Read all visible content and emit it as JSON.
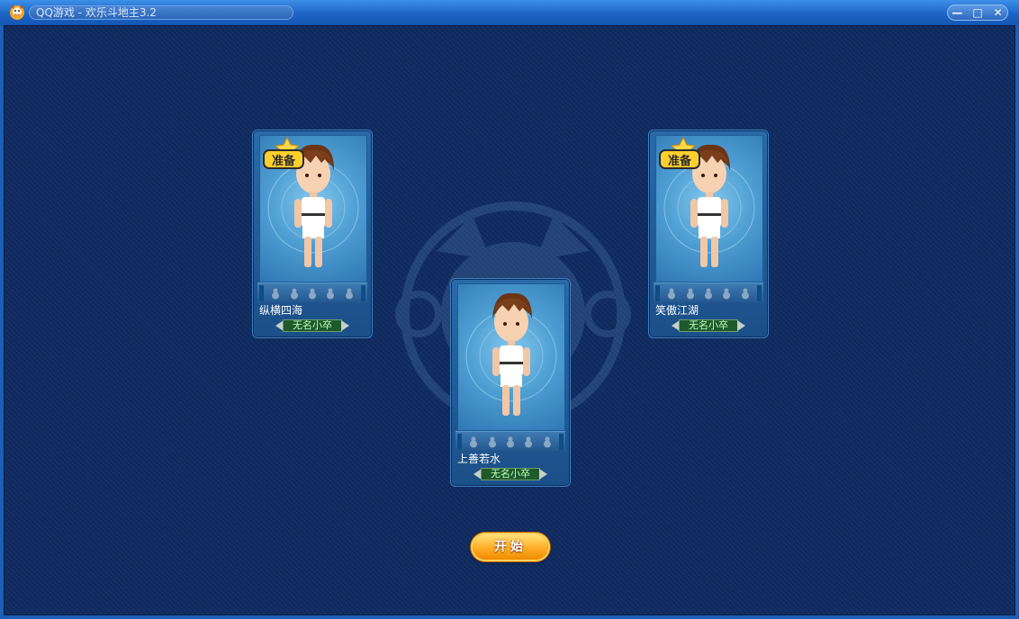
{
  "window": {
    "title": "QQ游戏 - 欢乐斗地主3.2",
    "controls": {
      "minimize": "—",
      "maximize": "□",
      "close": "✕"
    }
  },
  "players": [
    {
      "name": "纵横四海",
      "rank": "无名小卒",
      "status": "准备",
      "ready": true
    },
    {
      "name": "笑傲江湖",
      "rank": "无名小卒",
      "status": "准备",
      "ready": true
    },
    {
      "name": "上善若水",
      "rank": "无名小卒",
      "ready": false
    }
  ],
  "start_button": {
    "label": "开始"
  },
  "colors": {
    "background": "#0e2a60",
    "title_bar": "#1c64c6",
    "start_button": "#ffb12b",
    "rank_plate": "#1e5a2c"
  }
}
